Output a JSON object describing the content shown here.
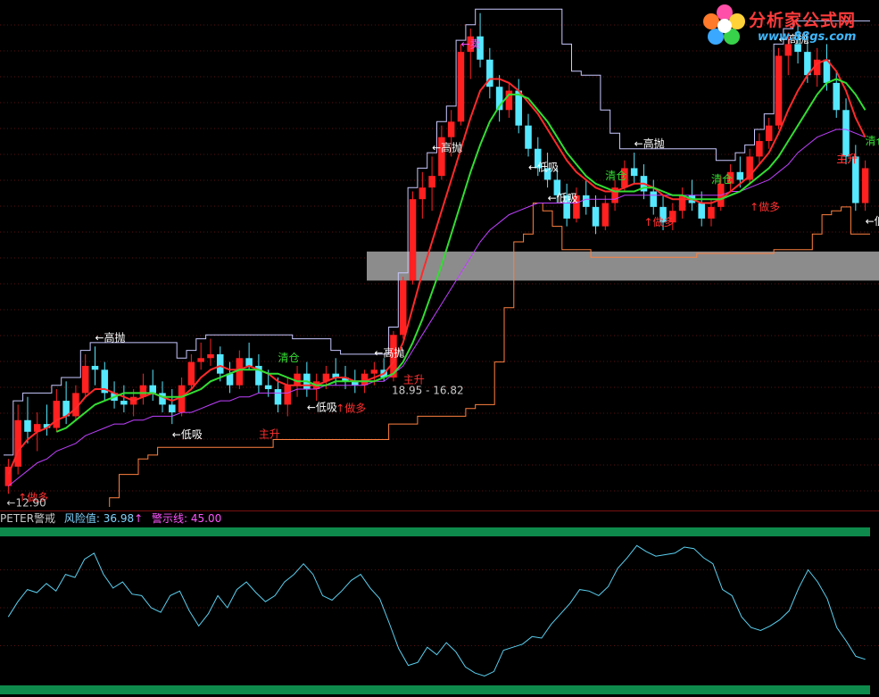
{
  "logo": {
    "title": "分析家公式网",
    "url": "www.88gs.com"
  },
  "indicator_header": {
    "name": "PETER警戒",
    "risk_label": "风险值: 36.98",
    "risk_arrow": "↑",
    "warn_label": "警示线: 45.00"
  },
  "colors": {
    "background": "#000000",
    "up_candle": "#ff2020",
    "down_candle": "#55e8ff",
    "ma_red": "#ff2a2a",
    "ma_green": "#33dd33",
    "ma_purple": "#c040ff",
    "stop_line": "#ff8040",
    "box_line": "#c8c8ff",
    "indicator_line": "#5ad0f0",
    "band_green": "#0e8a4c",
    "gray_band": "#8c8c8c"
  },
  "chart_data": [
    {
      "type": "candlestick",
      "title": "",
      "xlabel": "",
      "ylabel": "",
      "ylim": [
        12.5,
        25.3
      ],
      "grid": true,
      "candles": [
        [
          12.9,
          13.6,
          12.7,
          13.4
        ],
        [
          13.4,
          15.0,
          13.2,
          14.6
        ],
        [
          14.6,
          15.2,
          14.0,
          14.3
        ],
        [
          14.3,
          14.8,
          13.8,
          14.5
        ],
        [
          14.5,
          15.0,
          14.2,
          14.4
        ],
        [
          14.4,
          15.4,
          14.3,
          15.1
        ],
        [
          15.1,
          15.6,
          14.5,
          14.7
        ],
        [
          14.7,
          15.5,
          14.6,
          15.3
        ],
        [
          15.3,
          16.3,
          15.2,
          16.0
        ],
        [
          16.0,
          16.5,
          15.5,
          15.9
        ],
        [
          15.9,
          16.1,
          15.1,
          15.3
        ],
        [
          15.3,
          15.6,
          14.9,
          15.1
        ],
        [
          15.1,
          15.5,
          14.8,
          15.0
        ],
        [
          15.0,
          15.4,
          14.7,
          15.2
        ],
        [
          15.2,
          15.8,
          15.0,
          15.5
        ],
        [
          15.5,
          15.9,
          15.1,
          15.3
        ],
        [
          15.3,
          15.6,
          14.8,
          15.0
        ],
        [
          15.0,
          15.4,
          14.5,
          14.8
        ],
        [
          14.8,
          15.7,
          14.7,
          15.5
        ],
        [
          15.5,
          16.3,
          15.4,
          16.1
        ],
        [
          16.1,
          16.6,
          15.9,
          16.2
        ],
        [
          16.2,
          16.7,
          16.0,
          16.3
        ],
        [
          16.3,
          16.5,
          15.6,
          15.8
        ],
        [
          15.8,
          16.1,
          15.3,
          15.5
        ],
        [
          15.5,
          16.4,
          15.4,
          16.2
        ],
        [
          16.2,
          16.6,
          15.9,
          16.0
        ],
        [
          16.0,
          16.3,
          15.3,
          15.5
        ],
        [
          15.5,
          15.9,
          15.2,
          15.4
        ],
        [
          15.4,
          15.7,
          14.8,
          15.0
        ],
        [
          15.0,
          15.7,
          14.7,
          15.5
        ],
        [
          15.5,
          16.0,
          15.2,
          15.8
        ],
        [
          15.8,
          16.1,
          15.2,
          15.4
        ],
        [
          15.4,
          15.8,
          15.1,
          15.6
        ],
        [
          15.6,
          16.0,
          15.4,
          15.8
        ],
        [
          15.8,
          16.2,
          15.5,
          15.7
        ],
        [
          15.7,
          16.0,
          15.4,
          15.6
        ],
        [
          15.6,
          15.9,
          15.3,
          15.5
        ],
        [
          15.5,
          15.9,
          15.3,
          15.8
        ],
        [
          15.8,
          16.1,
          15.5,
          15.9
        ],
        [
          15.9,
          16.2,
          15.6,
          15.7
        ],
        [
          15.7,
          16.9,
          15.6,
          16.8
        ],
        [
          16.8,
          18.3,
          16.7,
          18.2
        ],
        [
          18.2,
          20.5,
          18.1,
          20.3
        ],
        [
          20.3,
          21.0,
          19.8,
          20.6
        ],
        [
          20.6,
          21.4,
          20.0,
          20.9
        ],
        [
          20.9,
          22.2,
          20.8,
          21.9
        ],
        [
          21.9,
          22.6,
          21.4,
          22.3
        ],
        [
          22.3,
          24.3,
          22.2,
          24.1
        ],
        [
          24.1,
          24.7,
          23.4,
          24.5
        ],
        [
          24.5,
          25.1,
          23.7,
          23.9
        ],
        [
          23.9,
          24.2,
          22.9,
          23.2
        ],
        [
          23.2,
          23.5,
          22.3,
          22.6
        ],
        [
          22.6,
          23.3,
          22.4,
          23.1
        ],
        [
          23.1,
          23.4,
          22.0,
          22.2
        ],
        [
          22.2,
          22.5,
          21.4,
          21.6
        ],
        [
          21.6,
          21.9,
          20.9,
          21.1
        ],
        [
          21.1,
          21.5,
          20.6,
          20.8
        ],
        [
          20.8,
          21.1,
          20.2,
          20.4
        ],
        [
          20.4,
          20.7,
          19.6,
          19.8
        ],
        [
          19.8,
          20.6,
          19.7,
          20.4
        ],
        [
          20.4,
          20.8,
          19.9,
          20.1
        ],
        [
          20.1,
          20.4,
          19.4,
          19.6
        ],
        [
          19.6,
          20.4,
          19.5,
          20.2
        ],
        [
          20.2,
          20.8,
          20.0,
          20.6
        ],
        [
          20.6,
          21.3,
          20.5,
          21.1
        ],
        [
          21.1,
          21.5,
          20.7,
          20.9
        ],
        [
          20.9,
          21.2,
          20.3,
          20.5
        ],
        [
          20.5,
          20.8,
          19.9,
          20.1
        ],
        [
          20.1,
          20.4,
          19.5,
          19.7
        ],
        [
          19.7,
          20.2,
          19.5,
          20.0
        ],
        [
          20.0,
          20.6,
          19.8,
          20.4
        ],
        [
          20.4,
          20.8,
          20.0,
          20.2
        ],
        [
          20.2,
          20.5,
          19.6,
          19.8
        ],
        [
          19.8,
          20.3,
          19.6,
          20.1
        ],
        [
          20.1,
          20.9,
          20.0,
          20.7
        ],
        [
          20.7,
          21.2,
          20.5,
          21.0
        ],
        [
          21.0,
          21.4,
          20.6,
          20.8
        ],
        [
          20.8,
          21.6,
          20.7,
          21.4
        ],
        [
          21.4,
          22.0,
          21.2,
          21.8
        ],
        [
          21.8,
          22.4,
          21.6,
          22.2
        ],
        [
          22.2,
          24.2,
          22.1,
          24.0
        ],
        [
          24.0,
          24.6,
          23.5,
          24.3
        ],
        [
          24.3,
          24.8,
          23.8,
          24.1
        ],
        [
          24.1,
          24.5,
          23.3,
          23.5
        ],
        [
          23.5,
          24.2,
          23.2,
          23.9
        ],
        [
          23.9,
          24.3,
          23.1,
          23.3
        ],
        [
          23.3,
          23.6,
          22.4,
          22.6
        ],
        [
          22.6,
          22.9,
          21.2,
          21.4
        ],
        [
          21.4,
          21.7,
          20.0,
          20.2
        ],
        [
          20.2,
          21.3,
          20.0,
          21.1
        ]
      ],
      "ma_red": [
        13.2,
        13.8,
        14.1,
        14.3,
        14.4,
        14.6,
        14.7,
        14.9,
        15.2,
        15.4,
        15.4,
        15.3,
        15.2,
        15.1,
        15.2,
        15.3,
        15.2,
        15.1,
        15.2,
        15.4,
        15.7,
        15.9,
        16.0,
        15.9,
        15.9,
        16.0,
        15.9,
        15.8,
        15.6,
        15.5,
        15.5,
        15.5,
        15.5,
        15.6,
        15.7,
        15.7,
        15.6,
        15.6,
        15.7,
        15.8,
        16.1,
        16.6,
        17.5,
        18.4,
        19.2,
        20.0,
        20.8,
        21.6,
        22.4,
        23.1,
        23.4,
        23.4,
        23.3,
        23.1,
        22.8,
        22.5,
        22.1,
        21.7,
        21.3,
        21.0,
        20.8,
        20.6,
        20.5,
        20.5,
        20.6,
        20.7,
        20.7,
        20.6,
        20.4,
        20.3,
        20.3,
        20.3,
        20.2,
        20.2,
        20.3,
        20.5,
        20.7,
        20.9,
        21.2,
        21.5,
        22.0,
        22.6,
        23.1,
        23.5,
        23.8,
        23.9,
        23.6,
        23.1,
        22.4,
        21.9
      ],
      "ma_green": [
        null,
        null,
        null,
        null,
        null,
        14.3,
        14.4,
        14.6,
        14.8,
        15.0,
        15.1,
        15.2,
        15.3,
        15.3,
        15.3,
        15.3,
        15.2,
        15.2,
        15.2,
        15.3,
        15.4,
        15.6,
        15.7,
        15.8,
        15.9,
        15.9,
        15.9,
        15.8,
        15.8,
        15.7,
        15.6,
        15.6,
        15.5,
        15.5,
        15.6,
        15.6,
        15.6,
        15.6,
        15.6,
        15.7,
        15.8,
        16.1,
        16.6,
        17.2,
        17.9,
        18.6,
        19.4,
        20.2,
        21.0,
        21.7,
        22.3,
        22.7,
        23.0,
        23.0,
        22.9,
        22.6,
        22.3,
        21.9,
        21.5,
        21.2,
        20.9,
        20.7,
        20.6,
        20.5,
        20.5,
        20.5,
        20.6,
        20.6,
        20.5,
        20.4,
        20.4,
        20.3,
        20.3,
        20.3,
        20.3,
        20.4,
        20.5,
        20.7,
        20.9,
        21.1,
        21.4,
        21.8,
        22.2,
        22.6,
        23.0,
        23.3,
        23.4,
        23.3,
        23.0,
        22.6
      ],
      "ma_purple": [
        12.9,
        13.1,
        13.3,
        13.5,
        13.6,
        13.8,
        13.9,
        14.0,
        14.2,
        14.3,
        14.4,
        14.5,
        14.5,
        14.6,
        14.6,
        14.7,
        14.7,
        14.7,
        14.8,
        14.8,
        14.9,
        15.0,
        15.1,
        15.1,
        15.2,
        15.2,
        15.3,
        15.3,
        15.3,
        15.3,
        15.4,
        15.4,
        15.4,
        15.5,
        15.5,
        15.5,
        15.5,
        15.5,
        15.6,
        15.6,
        15.8,
        16.0,
        16.4,
        16.8,
        17.2,
        17.6,
        18.0,
        18.4,
        18.8,
        19.2,
        19.5,
        19.7,
        19.9,
        20.0,
        20.1,
        20.2,
        20.2,
        20.2,
        20.2,
        20.2,
        20.3,
        20.3,
        20.3,
        20.3,
        20.4,
        20.4,
        20.4,
        20.4,
        20.4,
        20.4,
        20.4,
        20.4,
        20.4,
        20.4,
        20.4,
        20.5,
        20.5,
        20.6,
        20.7,
        20.8,
        21.0,
        21.2,
        21.5,
        21.7,
        21.9,
        22.0,
        22.1,
        22.1,
        22.0,
        21.9
      ],
      "price_labels": [
        {
          "i": 0,
          "text": "←12.90",
          "color": "#c8c8c8"
        },
        {
          "i": 40,
          "text": "18.95 - 16.82",
          "color": "#c8c8c8"
        }
      ],
      "annotations": [
        {
          "i": 9,
          "text": "←高抛",
          "color": "#ffffff"
        },
        {
          "i": 38,
          "text": "←高抛",
          "color": "#ffffff"
        },
        {
          "i": 44,
          "text": "←高抛",
          "color": "#ffffff"
        },
        {
          "i": 65,
          "text": "←高抛",
          "color": "#ffffff"
        },
        {
          "i": 80,
          "text": "←高抛",
          "color": "#ffffff"
        },
        {
          "i": 17,
          "text": "←低吸",
          "color": "#ffffff"
        },
        {
          "i": 31,
          "text": "←低吸",
          "color": "#ffffff"
        },
        {
          "i": 54,
          "text": "←低吸",
          "color": "#ffffff"
        },
        {
          "i": 56,
          "text": "←低吸",
          "color": "#ffffff"
        },
        {
          "i": 89,
          "text": "←低吸",
          "color": "#ffffff"
        },
        {
          "i": 1,
          "text": "↑做多",
          "color": "#ff3030"
        },
        {
          "i": 34,
          "text": "↑做多",
          "color": "#ff3030"
        },
        {
          "i": 66,
          "text": "↑做多",
          "color": "#ff3030"
        },
        {
          "i": 77,
          "text": "↑做多",
          "color": "#ff3030"
        },
        {
          "i": 28,
          "text": "清仓",
          "color": "#33dd33"
        },
        {
          "i": 62,
          "text": "清仓",
          "color": "#33dd33"
        },
        {
          "i": 73,
          "text": "清仓",
          "color": "#33dd33"
        },
        {
          "i": 89,
          "text": "清仓",
          "color": "#33dd33"
        },
        {
          "i": 26,
          "text": "主升",
          "color": "#ff3030"
        },
        {
          "i": 41,
          "text": "主升",
          "color": "#ff3030"
        },
        {
          "i": 86,
          "text": "主升",
          "color": "#ff3030"
        },
        {
          "i": 86,
          "text": "主升",
          "color": "#ff3030"
        },
        {
          "i": 47,
          "text": "←卖",
          "color": "#ff55ff"
        }
      ],
      "extra_labels": {
        "left_buy": "做多",
        "zhusheng_right": "主升",
        "zhusheng_band": "主升"
      }
    },
    {
      "type": "line",
      "title": "",
      "series": [
        {
          "values": [
            44,
            54,
            62,
            60,
            66,
            61,
            72,
            70,
            82,
            86,
            72,
            63,
            67,
            59,
            58,
            50,
            47,
            58,
            61,
            48,
            38,
            46,
            58,
            50,
            62,
            67,
            60,
            54,
            58,
            67,
            72,
            79,
            72,
            58,
            55,
            61,
            68,
            72,
            63,
            56,
            40,
            23,
            12,
            14,
            24,
            19,
            27,
            21,
            11,
            7,
            5,
            8,
            22,
            24,
            26,
            31,
            30,
            39,
            46,
            53,
            62,
            61,
            58,
            64,
            76,
            83,
            91,
            87,
            84,
            85,
            86,
            90,
            89,
            83,
            79,
            62,
            58,
            44,
            37,
            35,
            38,
            42,
            48,
            63,
            75,
            67,
            56,
            37,
            28,
            18,
            16
          ]
        }
      ],
      "warn_line": 45.0,
      "current_risk": 36.98,
      "ylim": [
        0,
        100
      ]
    }
  ]
}
